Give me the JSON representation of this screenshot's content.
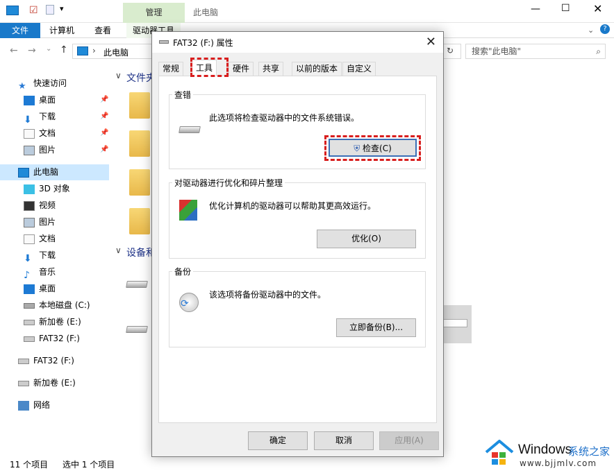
{
  "explorer": {
    "title": "此电脑",
    "ribbon_tabs": [
      "文件",
      "计算机",
      "查看",
      "驱动器工具"
    ],
    "manage_label": "管理",
    "address": "此电脑",
    "search_placeholder": "搜索\"此电脑\"",
    "nav": {
      "quick_access": "快速访问",
      "quick_items": [
        "桌面",
        "下载",
        "文档",
        "图片"
      ],
      "this_pc": "此电脑",
      "pc_items": [
        "3D 对象",
        "视频",
        "图片",
        "文档",
        "下载",
        "音乐",
        "桌面",
        "本地磁盘 (C:)",
        "新加卷 (E:)",
        "FAT32 (F:)"
      ],
      "drives": [
        "FAT32 (F:)",
        "新加卷 (E:)"
      ],
      "network": "网络"
    },
    "main": {
      "folders_header": "文件夹",
      "devices_header": "设备和"
    },
    "status": {
      "count": "11 个项目",
      "selected": "选中 1 个项目"
    }
  },
  "dialog": {
    "title": "FAT32 (F:) 属性",
    "tabs": [
      "常规",
      "工具",
      "硬件",
      "共享",
      "以前的版本",
      "自定义"
    ],
    "active_tab": "工具",
    "check_group": {
      "title": "查错",
      "text": "此选项将检查驱动器中的文件系统错误。",
      "button": "检查(C)"
    },
    "optimize_group": {
      "title": "对驱动器进行优化和碎片整理",
      "text": "优化计算机的驱动器可以帮助其更高效运行。",
      "button": "优化(O)"
    },
    "backup_group": {
      "title": "备份",
      "text": "该选项将备份驱动器中的文件。",
      "button": "立即备份(B)..."
    },
    "footer": {
      "ok": "确定",
      "cancel": "取消",
      "apply": "应用(A)"
    }
  },
  "watermark": {
    "brand": "Windows",
    "suffix": "系统之家",
    "url": "www.bjjmlv.com"
  },
  "colors": {
    "accent": "#1979ca",
    "highlight": "#d81e1e",
    "selected": "#cce8ff"
  }
}
